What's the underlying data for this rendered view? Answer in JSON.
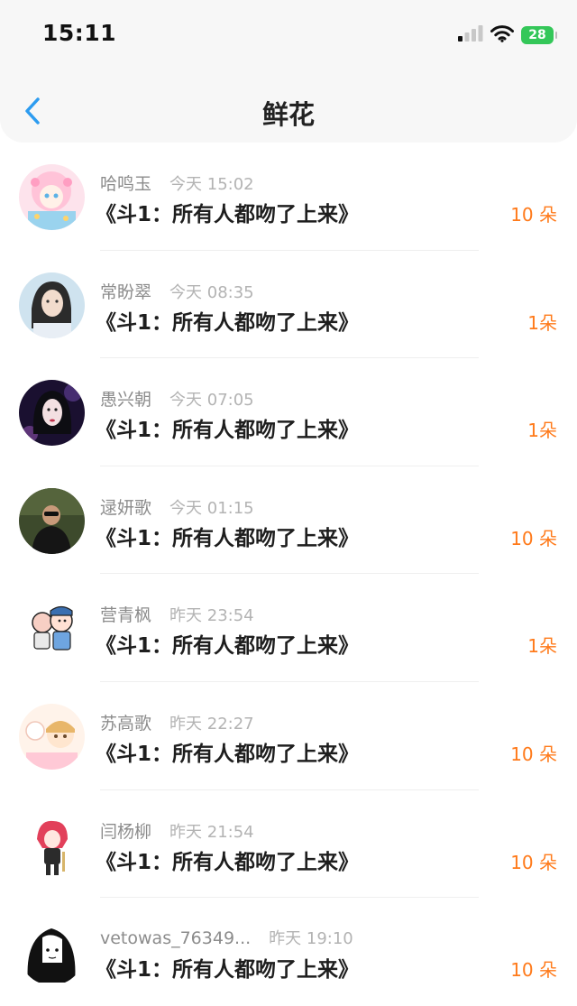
{
  "status": {
    "time": "15:11",
    "battery": "28"
  },
  "nav": {
    "title": "鲜花"
  },
  "colors": {
    "accent_blue": "#2d9cf0",
    "count_orange": "#ff7a1a",
    "battery_green": "#34c759"
  },
  "items": [
    {
      "name": "哈鸣玉",
      "time": "今天 15:02",
      "book": "《斗1：所有人都吻了上来》",
      "count": "10 朵"
    },
    {
      "name": "常盼翠",
      "time": "今天 08:35",
      "book": "《斗1：所有人都吻了上来》",
      "count": "1朵"
    },
    {
      "name": "愚兴朝",
      "time": "今天 07:05",
      "book": "《斗1：所有人都吻了上来》",
      "count": "1朵"
    },
    {
      "name": "逯妍歌",
      "time": "今天 01:15",
      "book": "《斗1：所有人都吻了上来》",
      "count": "10 朵"
    },
    {
      "name": "营青枫",
      "time": "昨天 23:54",
      "book": "《斗1：所有人都吻了上来》",
      "count": "1朵"
    },
    {
      "name": "苏高歌",
      "time": "昨天 22:27",
      "book": "《斗1：所有人都吻了上来》",
      "count": "10 朵"
    },
    {
      "name": "闫杨柳",
      "time": "昨天 21:54",
      "book": "《斗1：所有人都吻了上来》",
      "count": "10 朵"
    },
    {
      "name": "vetowas_76349...",
      "time": "昨天 19:10",
      "book": "《斗1：所有人都吻了上来》",
      "count": "10 朵"
    }
  ]
}
